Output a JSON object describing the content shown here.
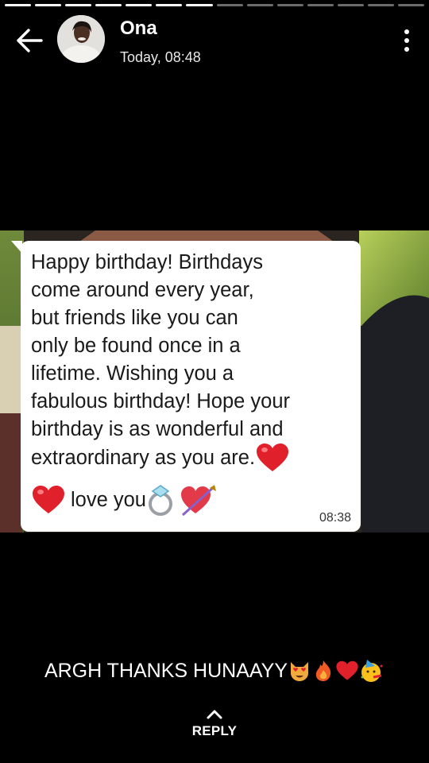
{
  "status": {
    "segments_total": 14,
    "segments_viewed": 7
  },
  "header": {
    "contact_name": "Ona",
    "timestamp": "Today, 08:48",
    "back_icon": "arrow-left-icon",
    "menu_icon": "more-vertical-icon"
  },
  "message": {
    "text": "Happy birthday! Birthdays\ncome around every year,\nbut friends like you can\nonly be found once in a\nlifetime. Wishing you a\nfabulous birthday! Hope your\nbirthday is as wonderful and",
    "line_extra": "extraordinary as you are.",
    "line_love": "love you",
    "time": "08:38",
    "emojis": [
      "heart-icon",
      "heart-icon",
      "ring-icon",
      "heart-arrow-icon"
    ]
  },
  "caption": {
    "text": "ARGH THANKS HUNAAYY",
    "emojis": [
      "heart-eyes-cat-icon",
      "fire-icon",
      "heart-icon",
      "party-face-icon"
    ]
  },
  "reply": {
    "label": "REPLY",
    "icon": "chevron-up-icon"
  },
  "colors": {
    "background": "#000000",
    "bubble": "#ffffff",
    "heart": "#e0202a"
  }
}
